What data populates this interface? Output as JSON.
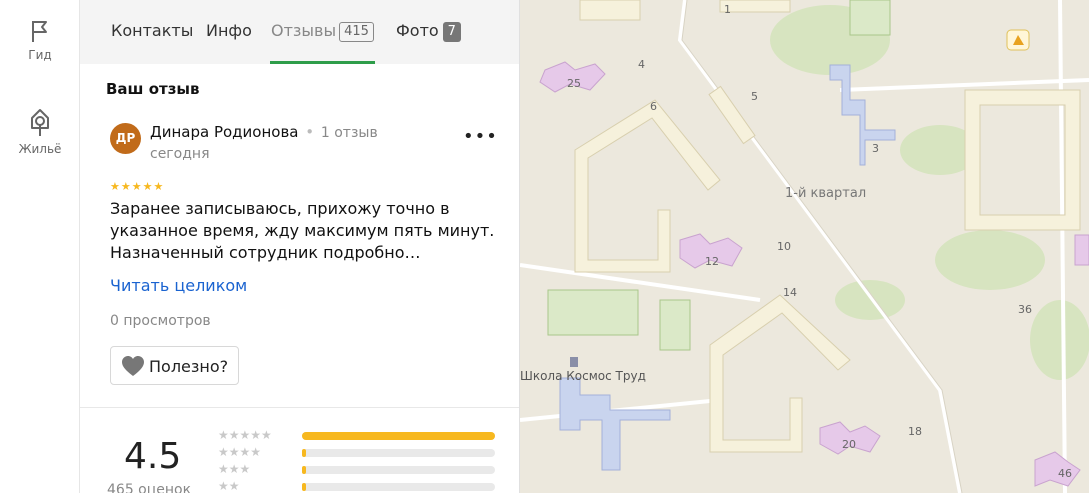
{
  "rail": {
    "items": [
      {
        "label": "Гид",
        "icon": "flag-icon"
      },
      {
        "label": "Жильё",
        "icon": "home-search-icon"
      }
    ]
  },
  "tabs": [
    {
      "label": "Контакты"
    },
    {
      "label": "Инфо"
    },
    {
      "label": "Отзывы",
      "count": "415",
      "active": true
    },
    {
      "label": "Фото",
      "count": "7"
    }
  ],
  "review": {
    "section_title": "Ваш отзыв",
    "avatar_initials": "ДР",
    "avatar_color": "#c16b1a",
    "author": "Динара Родионова",
    "review_count": "1 отзыв",
    "date": "сегодня",
    "rating": 5,
    "text": "Заранее записываюсь, прихожу точно в указанное время, жду максимум пять минут. Назначенный сотрудник подробно…",
    "read_more": "Читать целиком",
    "views": "0 просмотров",
    "helpful_label": "Полезно?"
  },
  "rating_summary": {
    "average": "4.5",
    "count_label": "465 оценок",
    "distribution": [
      {
        "stars": 5,
        "fraction": 1.0
      },
      {
        "stars": 4,
        "fraction": 0.02
      },
      {
        "stars": 3,
        "fraction": 0.02
      },
      {
        "stars": 2,
        "fraction": 0.02
      }
    ],
    "accent_color": "#f7b81f"
  },
  "map": {
    "labels": [
      {
        "text": "1"
      },
      {
        "text": "4"
      },
      {
        "text": "25"
      },
      {
        "text": "5"
      },
      {
        "text": "6"
      },
      {
        "text": "3"
      },
      {
        "text": "1-й квартал"
      },
      {
        "text": "10"
      },
      {
        "text": "12"
      },
      {
        "text": "14"
      },
      {
        "text": "36"
      },
      {
        "text": "Школа Космос Труд"
      },
      {
        "text": "18"
      },
      {
        "text": "20"
      },
      {
        "text": "46"
      }
    ]
  },
  "colors": {
    "tab_underline": "#2e9d4a",
    "link": "#1a63d0",
    "map_bg": "#ece8dd"
  }
}
